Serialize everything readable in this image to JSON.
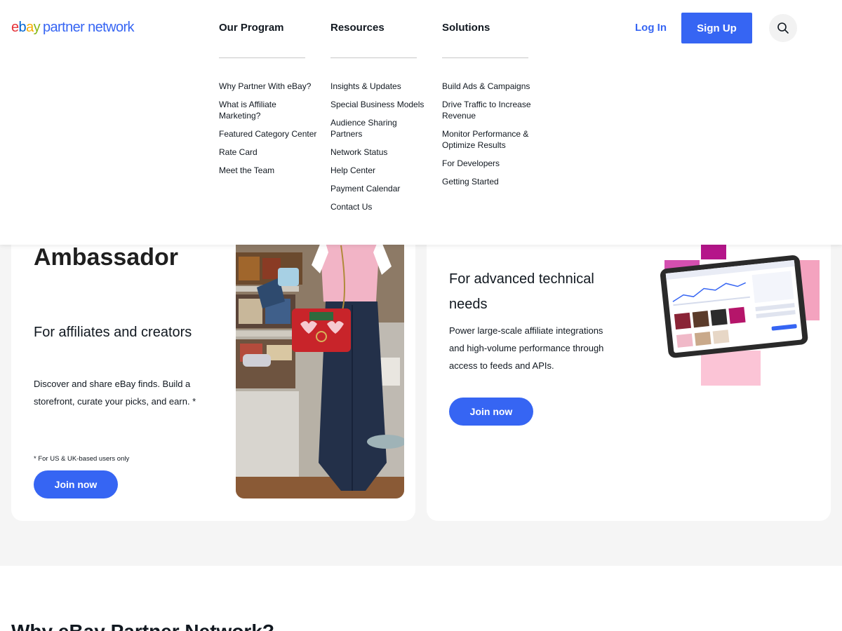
{
  "logo": {
    "e": "e",
    "b": "b",
    "a": "a",
    "y": "y",
    "rest": "partner network"
  },
  "nav": [
    {
      "label": "Our Program",
      "items": [
        "Why Partner With eBay?",
        "What is Affiliate Marketing?",
        "Featured Category Center",
        "Rate Card",
        "Meet the Team"
      ]
    },
    {
      "label": "Resources",
      "items": [
        "Insights & Updates",
        "Special Business Models",
        "Audience Sharing Partners",
        "Network Status",
        "Help Center",
        "Payment Calendar",
        "Contact Us"
      ]
    },
    {
      "label": "Solutions",
      "items": [
        "Build Ads & Campaigns",
        "Drive Traffic to Increase Revenue",
        "Monitor Performance & Optimize Results",
        "For Developers",
        "Getting Started"
      ]
    }
  ],
  "header": {
    "login": "Log In",
    "signup": "Sign Up",
    "search_icon": "search-icon"
  },
  "card_left": {
    "title": "Ambassador",
    "subtitle": "For affiliates and creators",
    "description": "Discover and share eBay finds. Build a storefront, curate your picks, and earn. *",
    "note": "* For US & UK-based users only",
    "cta": "Join now"
  },
  "card_right": {
    "subtitle": "For advanced technical needs",
    "description": "Power large-scale affiliate integrations and high-volume performance through access to feeds and APIs.",
    "cta": "Join now"
  },
  "section": {
    "heading": "Why eBay Partner Network?"
  },
  "colors": {
    "primary": "#3665f3",
    "magenta": "#b5158a",
    "pink": "#f4a3bf",
    "text": "#111820"
  }
}
